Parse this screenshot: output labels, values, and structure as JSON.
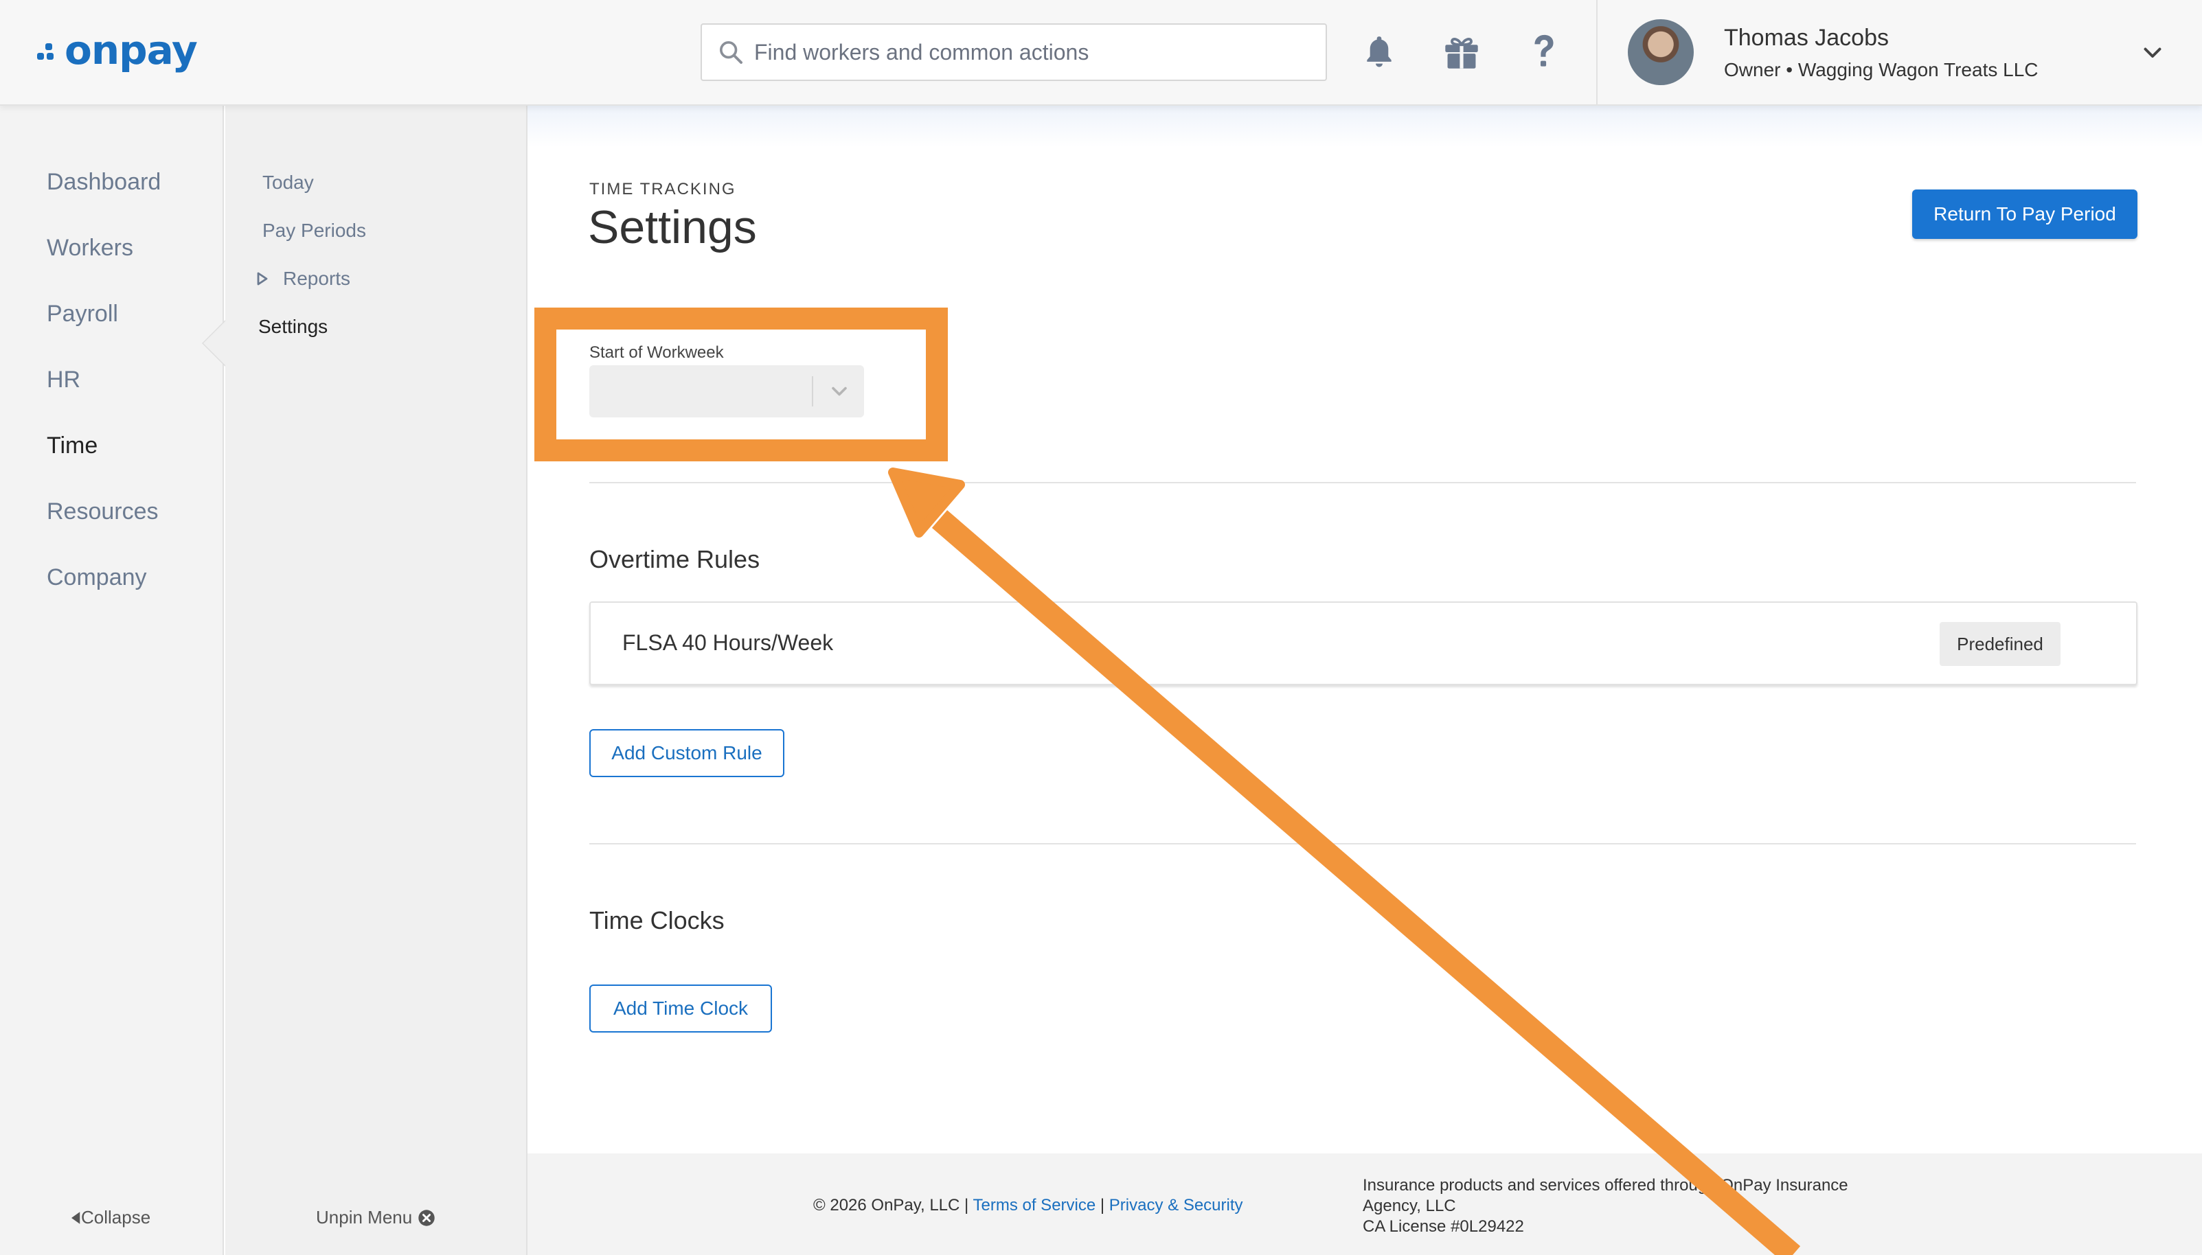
{
  "brand": {
    "logo_text": "onpay",
    "logo_color": "#1a6fbf"
  },
  "search": {
    "placeholder": "Find workers and common actions"
  },
  "header_icons": [
    "bell-icon",
    "gift-icon",
    "question-icon"
  ],
  "user": {
    "name": "Thomas Jacobs",
    "role": "Owner • Wagging Wagon Treats LLC"
  },
  "primary_nav": {
    "items": [
      {
        "label": "Dashboard"
      },
      {
        "label": "Workers"
      },
      {
        "label": "Payroll"
      },
      {
        "label": "HR"
      },
      {
        "label": "Time",
        "active": true
      },
      {
        "label": "Resources"
      },
      {
        "label": "Company"
      }
    ],
    "collapse_label": "Collapse"
  },
  "secondary_nav": {
    "items": [
      {
        "label": "Today"
      },
      {
        "label": "Pay Periods"
      },
      {
        "label": "Reports",
        "expandable": true
      },
      {
        "label": "Settings",
        "active": true
      }
    ],
    "unpin_label": "Unpin Menu"
  },
  "page": {
    "eyebrow": "TIME TRACKING",
    "title": "Settings",
    "return_button": "Return To Pay Period"
  },
  "workweek": {
    "label": "Start of Workweek",
    "value": ""
  },
  "overtime": {
    "heading": "Overtime Rules",
    "rules": [
      {
        "name": "FLSA 40 Hours/Week",
        "badge": "Predefined"
      }
    ],
    "add_button": "Add Custom Rule"
  },
  "time_clocks": {
    "heading": "Time Clocks",
    "add_button": "Add Time Clock"
  },
  "footer": {
    "copyright": "© 2026 OnPay, LLC |",
    "terms": "Terms of Service",
    "sep": "|",
    "privacy": "Privacy & Security",
    "insurance_line1": "Insurance products and services offered through OnPay Insurance",
    "insurance_line2": "Agency, LLC",
    "insurance_line3": "CA License #0L29422"
  },
  "colors": {
    "accent": "#1a75d2",
    "annotation": "#f2953b"
  }
}
